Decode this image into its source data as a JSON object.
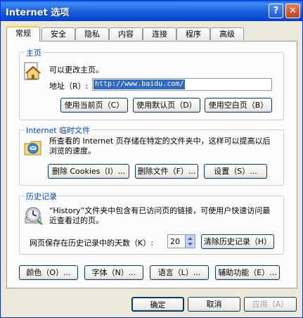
{
  "window": {
    "title": "Internet 选项",
    "help_glyph": "?",
    "close_glyph": "✕"
  },
  "tabs": [
    "常规",
    "安全",
    "隐私",
    "内容",
    "连接",
    "程序",
    "高级"
  ],
  "home": {
    "group_title": "主页",
    "description": "可以更改主页。",
    "address_label": "地址（R）:",
    "address_value": "http://www.baidu.com/",
    "buttons": [
      "使用当前页（C）",
      "使用默认页（D）",
      "使用空白页（B）"
    ]
  },
  "temp": {
    "group_title": "Internet 临时文件",
    "description": "所查看的 Internet 页存储在特定的文件夹中，这样可以提高以后浏览的速度。",
    "buttons": [
      "删除 Cookies（I）...",
      "删除文件（F）...",
      "设置（S）..."
    ]
  },
  "history": {
    "group_title": "历史记录",
    "description": "“History”文件夹中包含有已访问页的链接，可使用户快速访问最近查看过的页。",
    "days_label": "网页保存在历史记录中的天数（K）:",
    "days_value": "20",
    "clear_button": "清除历史记录（H）"
  },
  "bottom_buttons": [
    "颜色（O）...",
    "字体（N）...",
    "语言（L）...",
    "辅助功能（E）..."
  ],
  "dialog_buttons": [
    "确定",
    "取消",
    "应用（A）"
  ]
}
